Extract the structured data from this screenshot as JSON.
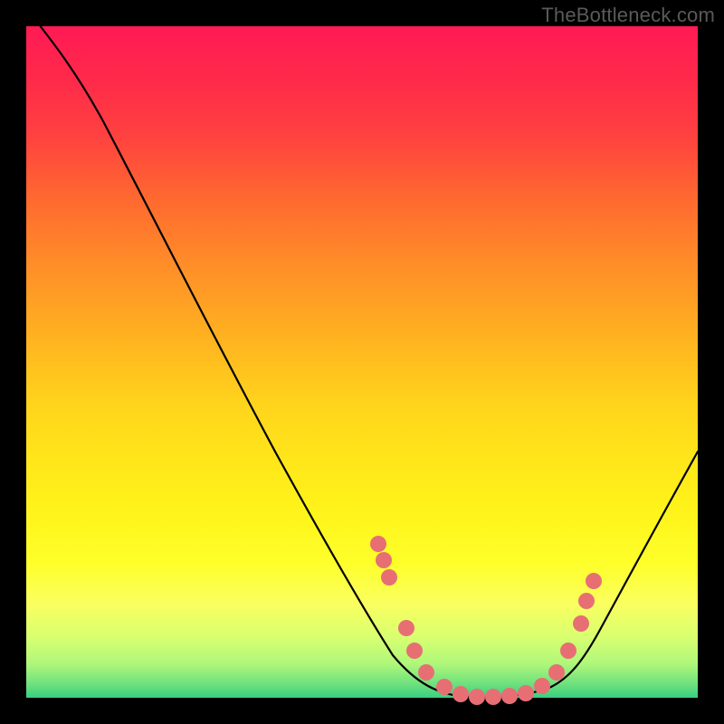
{
  "watermark": "TheBottleneck.com",
  "colors": {
    "background": "#000000",
    "curve": "#000000",
    "dot": "#e76f74",
    "gradient_top": "#ff1a55",
    "gradient_bottom": "#38cf82"
  },
  "chart_data": {
    "type": "line",
    "title": "",
    "xlabel": "",
    "ylabel": "",
    "xlim": [
      0,
      100
    ],
    "ylim": [
      0,
      100
    ],
    "x": [
      0,
      2,
      5,
      10,
      15,
      20,
      25,
      30,
      35,
      40,
      45,
      50,
      52,
      54,
      56,
      58,
      60,
      62,
      65,
      68,
      70,
      73,
      76,
      80,
      84,
      88,
      92,
      96,
      100
    ],
    "values": [
      103,
      100,
      97,
      91,
      84,
      76,
      68,
      60,
      52,
      44,
      36,
      27,
      23,
      19,
      14,
      10,
      6,
      3,
      1,
      0,
      0,
      0,
      1,
      4,
      10,
      18,
      27,
      36,
      45
    ],
    "highlight_points": {
      "x": [
        52,
        53.5,
        55,
        59,
        61,
        63,
        66,
        68,
        70,
        72,
        74,
        76,
        78,
        80,
        81.5,
        83,
        84.5
      ],
      "y": [
        22,
        19,
        16,
        8,
        5,
        2.5,
        1,
        0.3,
        0,
        0,
        0.2,
        0.8,
        2.5,
        5,
        8,
        12,
        16
      ]
    }
  }
}
